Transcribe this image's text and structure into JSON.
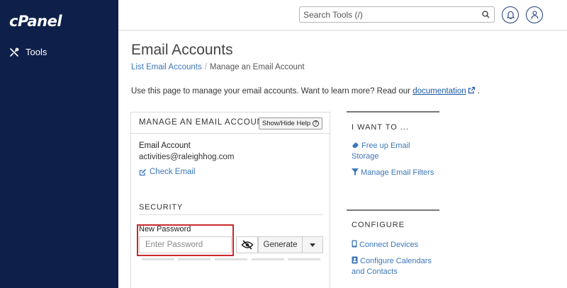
{
  "brand": {
    "logo_text": "cPanel"
  },
  "sidebar": {
    "items": [
      {
        "label": "Tools",
        "icon": "tools-icon"
      }
    ]
  },
  "topbar": {
    "search_placeholder": "Search Tools (/)",
    "icons": [
      "search-icon",
      "bell-icon",
      "user-icon"
    ]
  },
  "page": {
    "title": "Email Accounts",
    "breadcrumb": {
      "link": "List Email Accounts",
      "separator": "/",
      "current": "Manage an Email Account"
    },
    "intro_text": "Use this page to manage your email accounts. Want to learn more? Read our",
    "intro_link": "documentation",
    "intro_end": "."
  },
  "manage_panel": {
    "title": "MANAGE AN EMAIL ACCOUNT",
    "help_button": "Show/Hide Help",
    "account_label": "Email Account",
    "account_value": "activities@raleighhog.com",
    "check_email": "Check Email",
    "security_heading": "SECURITY",
    "new_password_label": "New Password",
    "password_placeholder": "Enter Password",
    "password_value": "",
    "generate_label": "Generate",
    "strength_segments": 5
  },
  "i_want_to": {
    "heading": "I WANT TO ...",
    "links": [
      {
        "line1": "Free up Email",
        "line2": "Storage",
        "icon": "eraser-icon"
      },
      {
        "line1": "Manage Email Filters",
        "line2": "",
        "icon": "filter-icon"
      }
    ]
  },
  "configure": {
    "heading": "CONFIGURE",
    "links": [
      {
        "line1": "Connect Devices",
        "line2": "",
        "icon": "mobile-icon"
      },
      {
        "line1": "Configure Calendars",
        "line2": "and Contacts",
        "icon": "address-book-icon"
      }
    ]
  },
  "colors": {
    "sidebar": "#0e2049",
    "link": "#3d77b6",
    "highlight": "#c9282d"
  }
}
